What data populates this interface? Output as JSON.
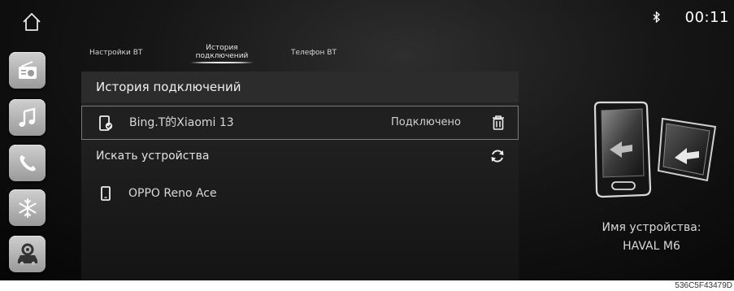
{
  "status_bar": {
    "time": "00:11",
    "bluetooth_icon": "bluetooth-icon"
  },
  "dock": {
    "items": [
      {
        "name": "home",
        "icon": "home-icon"
      },
      {
        "name": "radio",
        "icon": "radio-icon"
      },
      {
        "name": "music",
        "icon": "music-note-icon"
      },
      {
        "name": "phone",
        "icon": "phone-icon"
      },
      {
        "name": "climate",
        "icon": "snowflake-icon"
      },
      {
        "name": "car-settings",
        "icon": "car-settings-icon"
      }
    ]
  },
  "tabs": [
    {
      "label": "Настройки BT",
      "active": false
    },
    {
      "label_line1": "История",
      "label_line2": "подключений",
      "active": true
    },
    {
      "label": "Телефон BT",
      "active": false
    }
  ],
  "history": {
    "header": "История подключений",
    "connected_device": {
      "name": "Bing.T的Xiaomi 13",
      "status": "Подключено",
      "icon": "phone-check-icon",
      "action_icon": "trash-icon"
    }
  },
  "search": {
    "label": "Искать устройства",
    "action_icon": "refresh-icon"
  },
  "available_devices": [
    {
      "name": "OPPO Reno Ace",
      "icon": "phone-icon"
    }
  ],
  "device_info": {
    "label": "Имя устройства:",
    "value": "HAVAL M6"
  },
  "footer_code": "536C5F43479D",
  "colors": {
    "background": "#0a0a0a",
    "panel": "#1e1e1e",
    "tile": "#b5b5b5",
    "text": "#e0e0e0"
  }
}
